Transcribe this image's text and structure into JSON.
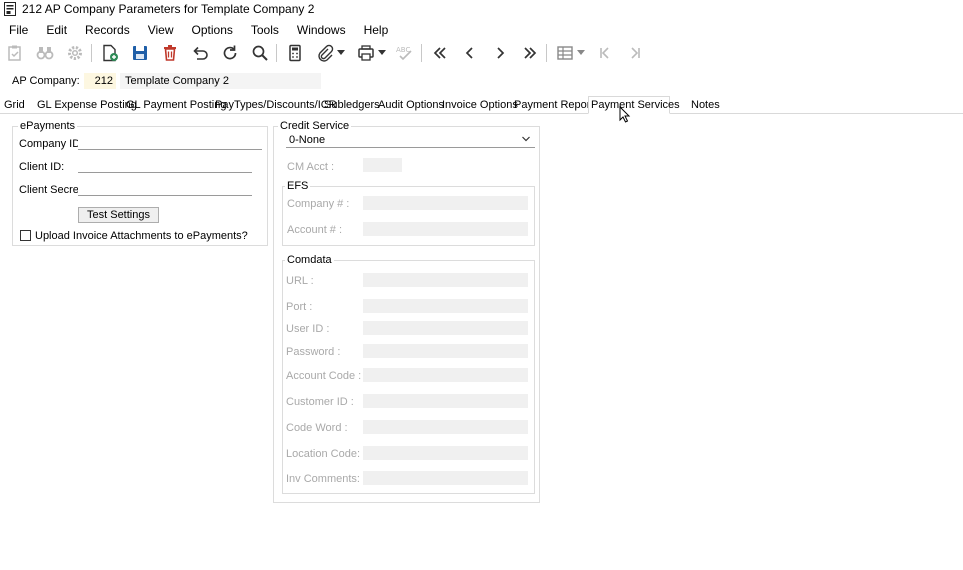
{
  "window": {
    "title": "212 AP Company Parameters for Template Company 2"
  },
  "menu": [
    "File",
    "Edit",
    "Records",
    "View",
    "Options",
    "Tools",
    "Windows",
    "Help"
  ],
  "company": {
    "label": "AP Company:",
    "number": "212",
    "name": "Template Company 2"
  },
  "tabs": [
    "Grid",
    "GL Expense Posting",
    "GL Payment Posting",
    "PayTypes/Discounts/ICR",
    "Subledgers",
    "Audit Options",
    "Invoice Options",
    "Payment Reports",
    "Payment Services",
    "Notes"
  ],
  "active_tab": "Payment Services",
  "epayments": {
    "title": "ePayments",
    "company_id_label": "Company ID:",
    "company_id_value": "",
    "client_id_label": "Client ID:",
    "client_id_value": "",
    "client_secret_label": "Client Secret:",
    "client_secret_value": "",
    "test_button": "Test Settings",
    "upload_label": "Upload Invoice Attachments to ePayments?",
    "upload_checked": false
  },
  "credit_service": {
    "title": "Credit Service",
    "selected": "0-None",
    "cm_acct_label": "CM Acct :",
    "efs": {
      "title": "EFS",
      "company_label": "Company # :",
      "account_label": "Account # :"
    },
    "comdata": {
      "title": "Comdata",
      "url_label": "URL :",
      "port_label": "Port :",
      "user_id_label": "User ID :",
      "password_label": "Password :",
      "account_code_label": "Account Code :",
      "customer_id_label": "Customer ID :",
      "code_word_label": "Code Word :",
      "location_code_label": "Location Code:",
      "inv_comments_label": "Inv Comments:"
    }
  },
  "colors": {
    "accent_blue": "#1f5fa8",
    "delete_red": "#c0392b",
    "disabled_text": "#a9a9a9",
    "company_num_bg": "#fdf7e1"
  }
}
